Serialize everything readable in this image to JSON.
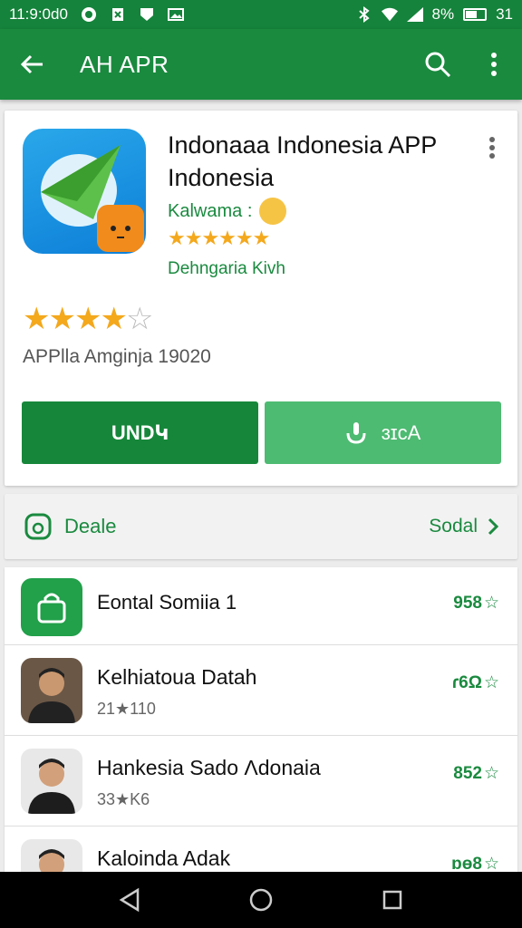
{
  "status_bar": {
    "time": "11:9:0d0",
    "battery": "8%",
    "clock_right": "31"
  },
  "app_bar": {
    "title": "AH APR"
  },
  "app": {
    "name": "Indonaaa Indonesia APP Indonesia",
    "developer": "Kalwama :",
    "small_rating_stars": "★★★★★★",
    "category": "Dehngaria Kivh",
    "rating": 4,
    "rating_max": 5,
    "meta": "APPlla Amginja 19020",
    "install_label": "UNDԿ",
    "secondary_label": "ɜɪcA"
  },
  "deals": {
    "label": "Deale",
    "more_label": "Sodal"
  },
  "list": {
    "items": [
      {
        "title": "Eontal Somiia 1",
        "subtitle": "",
        "rating": "958",
        "thumb": "bag-icon"
      },
      {
        "title": "Kelhiatoua Datah",
        "subtitle": "21★110",
        "rating": "ɾ6Ω",
        "thumb": "person-photo"
      },
      {
        "title": "Hankesia Sado Λdonaia",
        "subtitle": "33★K6",
        "rating": "852",
        "thumb": "person-photo"
      },
      {
        "title": "Kaloinda Adak",
        "subtitle": "",
        "rating": "ɒɵ8",
        "thumb": "person-photo"
      }
    ]
  },
  "colors": {
    "primary": "#1a8a3f",
    "primary_dark": "#15833b",
    "install": "#16873a",
    "secondary": "#4dbb72",
    "star": "#f4a81c"
  }
}
